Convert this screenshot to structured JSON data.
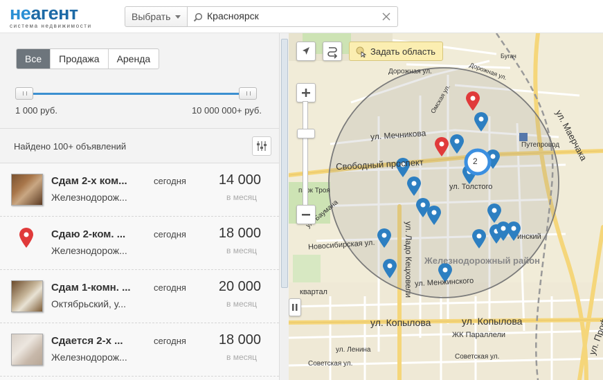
{
  "header": {
    "logo_main_ne": "не",
    "logo_main_agent": "агент",
    "logo_sub": "система недвижимости",
    "select_label": "Выбрать",
    "search_value": "Красноярск"
  },
  "filters": {
    "tabs": [
      "Все",
      "Продажа",
      "Аренда"
    ],
    "active_tab": "Все",
    "price_min": "1 000 руб.",
    "price_max": "10 000 000+ руб."
  },
  "results": {
    "found_text": "Найдено 100+ объявлений",
    "items": [
      {
        "title": "Сдам 2-х ком...",
        "address": "Железнодорож...",
        "date": "сегодня",
        "price": "14 000",
        "period": "в месяц",
        "thumb": "photo"
      },
      {
        "title": "Сдаю 2-ком. ...",
        "address": "Железнодорож...",
        "date": "сегодня",
        "price": "18 000",
        "period": "в месяц",
        "thumb": "map-pin-red-icon"
      },
      {
        "title": "Сдам 1-комн. ...",
        "address": "Октябрьский, у...",
        "date": "сегодня",
        "price": "20 000",
        "period": "в месяц",
        "thumb": "photo"
      },
      {
        "title": "Сдается 2-х ...",
        "address": "Железнодорож...",
        "date": "сегодня",
        "price": "18 000",
        "period": "в месяц",
        "thumb": "photo"
      }
    ]
  },
  "map": {
    "area_button": "Задать область",
    "cluster_count": "2",
    "labels": {
      "mechnikova": "ул. Мечникова",
      "svobodny": "Свободный проспект",
      "tolstogo": "ул. Толстого",
      "park": "парк Троя",
      "baumana": "ул. Баумана",
      "novosibirskaya": "Новосибирская ул.",
      "kecchoveli": "ул. Ладо Кецховели",
      "district": "Железнодорожный район",
      "menzhinskogo": "ул. Менжинского",
      "kopylova1": "ул. Копылова",
      "kopylova2": "ул. Копылова",
      "parallel": "ЖК Параллели",
      "lenina": "ул. Ленина",
      "sovetskaya1": "Советская ул.",
      "sovetskaya2": "Советская ул.",
      "marjaka": "ул. Маерчака",
      "profsoyuzov": "ул. Профсоюзов",
      "putieprovod": "Путепровод",
      "dorozhnaya": "Дорожная ул.",
      "dorozhnaya2": "Дорожная ул.",
      "omskaya": "Омская ул.",
      "bugach": "Бугач",
      "kvartal": "квартал",
      "kinskiy": "инский"
    },
    "colors": {
      "blue_pin": "#2d7fc1",
      "red_pin": "#e03a3a",
      "radius_circle": "#7a7a7a"
    }
  }
}
